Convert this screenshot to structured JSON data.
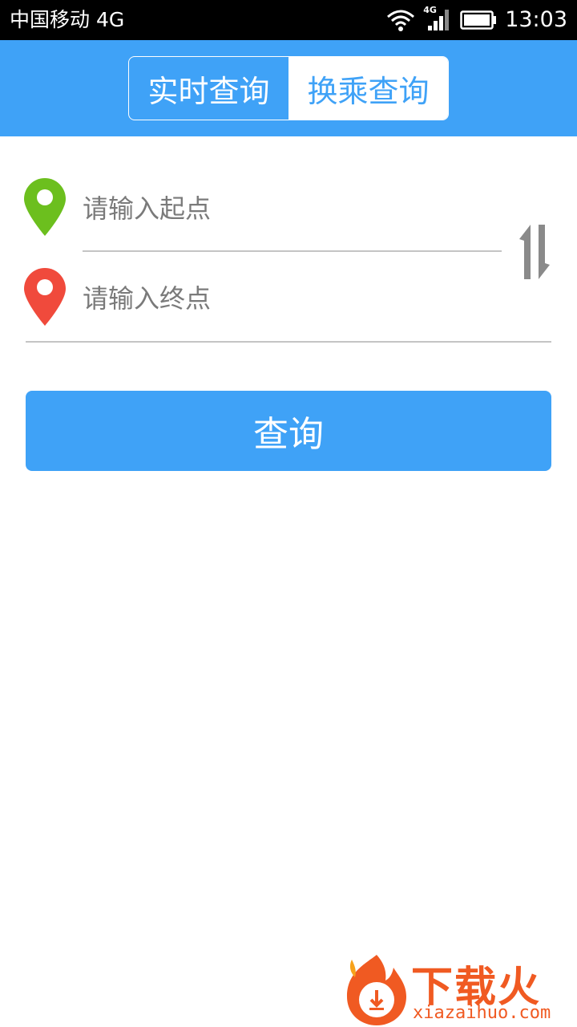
{
  "status_bar": {
    "carrier": "中国移动 4G",
    "network_badge": "4G",
    "time": "13:03",
    "icons": [
      "wifi-icon",
      "signal-icon",
      "battery-icon"
    ]
  },
  "tabs": [
    {
      "label": "实时查询",
      "active": false
    },
    {
      "label": "换乘查询",
      "active": true
    }
  ],
  "form": {
    "start_placeholder": "请输入起点",
    "end_placeholder": "请输入终点",
    "start_value": "",
    "end_value": "",
    "swap_icon": "swap-vertical-icon"
  },
  "query_button": {
    "label": "查询"
  },
  "watermark": {
    "title": "下载火",
    "url": "xiazaihuo.com"
  },
  "colors": {
    "brand": "#3fa2f7",
    "start_pin": "#6cbf1e",
    "end_pin": "#f04a3c",
    "watermark": "#f05a22"
  }
}
